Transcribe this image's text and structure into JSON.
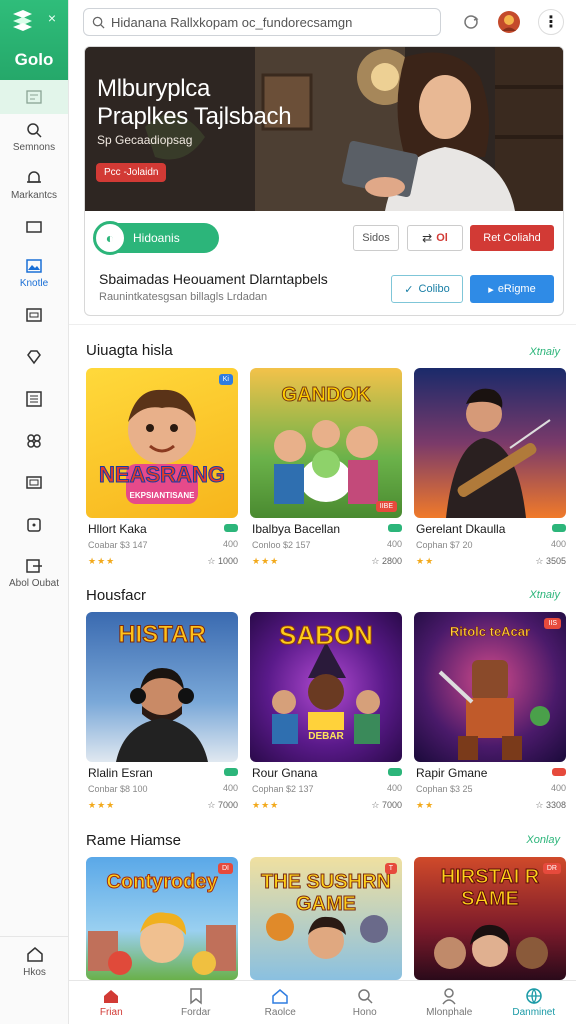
{
  "app": {
    "brand_name": "Golo",
    "close_glyph": "×"
  },
  "sidebar": {
    "items": [
      {
        "label": "Semnons",
        "icon": "search-icon"
      },
      {
        "label": "Markantcs",
        "icon": "bell-icon"
      },
      {
        "label": "",
        "icon": "folder-icon"
      },
      {
        "label": "Knotle",
        "icon": "image-icon",
        "active": true
      },
      {
        "label": "",
        "icon": "calendar-icon"
      },
      {
        "label": "",
        "icon": "gem-icon"
      },
      {
        "label": "",
        "icon": "list-icon"
      },
      {
        "label": "",
        "icon": "gamepad-icon"
      },
      {
        "label": "",
        "icon": "tv-icon"
      },
      {
        "label": "",
        "icon": "wallet-icon"
      },
      {
        "label": "Abol Oubat",
        "icon": "logout-icon"
      }
    ],
    "bottom_label": "Hkos"
  },
  "search": {
    "value": "Hidanana Rallxkopam oc_fundorecsamgn"
  },
  "hero": {
    "title_line1": "Mlburyplca",
    "title_line2": "Praplkes Tajlsbach",
    "subtitle": "Sp Gecaadiopsag",
    "tag": "Pcc -Jolaidn",
    "pill_label": "Hidoanis",
    "btn1": "Sidos",
    "btn2": "Ol",
    "btn3": "Ret Coliahd",
    "heading": "Sbaimadas  Heouament Dlarntapbels",
    "description": "Raunintkatesgsan billagls Lrdadan",
    "btn4": "Colibo",
    "btn5": "eRigme"
  },
  "sections": [
    {
      "title": "Uiuagta hisla",
      "more": "Xtnaiy",
      "cards": [
        {
          "title": "Hllort Kaka",
          "sub": "Coabar $3 147",
          "num": "400",
          "stars": "★★★",
          "count": "1000",
          "art": "NEASRANG",
          "art_sub": "EKPSIANTISANE",
          "badge": "Ki"
        },
        {
          "title": "Ibalbya Bacellan",
          "sub": "Conloo $2 157",
          "num": "400",
          "stars": "★★★",
          "count": "2800",
          "art": "GANDOK",
          "badge": "IIBE"
        },
        {
          "title": "Gerelant Dkaulla",
          "sub": "Cophan $7 20",
          "num": "400",
          "stars": "★★",
          "count": "3505",
          "art": ""
        }
      ]
    },
    {
      "title": "Housfacr",
      "more": "Xtnaiy",
      "cards": [
        {
          "title": "Rlalin Esran",
          "sub": "Conbar $8 100",
          "num": "400",
          "stars": "★★★",
          "count": "7000",
          "art": "HISTAR"
        },
        {
          "title": "Rour Gnana",
          "sub": "Cophan $2 137",
          "num": "400",
          "stars": "★★★",
          "count": "7000",
          "art": "SABON",
          "art_sub": "DEBAR"
        },
        {
          "title": "Rapir Gmane",
          "sub": "Cophan $3 25",
          "num": "400",
          "stars": "★★",
          "count": "3308",
          "art": "Ritolc teAcar",
          "badge": "IIS"
        }
      ]
    },
    {
      "title": "Rame Hiamse",
      "more": "Xonlay",
      "cards": [
        {
          "title": "",
          "sub": "",
          "num": "",
          "stars": "",
          "count": "",
          "art": "Contyrodey",
          "badge": "DI"
        },
        {
          "title": "",
          "sub": "",
          "num": "",
          "stars": "",
          "count": "",
          "art": "THE SUSHRN GAME",
          "badge": "T"
        },
        {
          "title": "",
          "sub": "",
          "num": "",
          "stars": "",
          "count": "",
          "art": "HIRSTAI R SAME",
          "badge": "DR"
        }
      ]
    }
  ],
  "bottom_nav": [
    {
      "label": "Frian",
      "icon": "home-icon",
      "state": "active"
    },
    {
      "label": "Fordar",
      "icon": "bookmark-icon"
    },
    {
      "label": "Raolce",
      "icon": "house-icon"
    },
    {
      "label": "Hono",
      "icon": "search-icon"
    },
    {
      "label": "Mlonphale",
      "icon": "user-icon"
    },
    {
      "label": "Danminet",
      "icon": "globe-icon",
      "state": "teal"
    }
  ],
  "colors": {
    "brand_green": "#2cb57a",
    "accent_red": "#d23a35",
    "accent_blue": "#2f7de1",
    "link_teal": "#1a9aa6"
  }
}
